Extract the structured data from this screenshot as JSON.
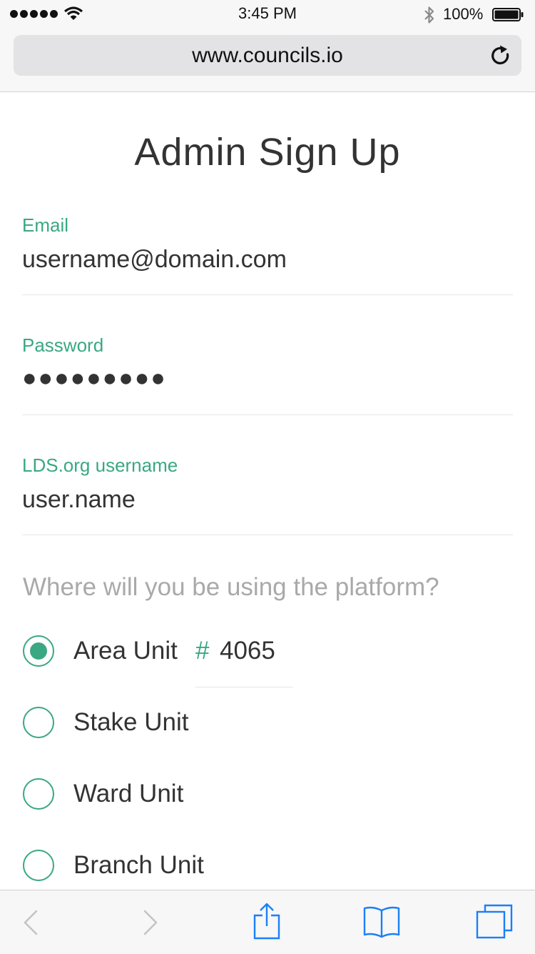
{
  "status_bar": {
    "time": "3:45 PM",
    "battery": "100%",
    "signal_icon": "signal-dots-icon",
    "wifi_icon": "wifi-icon",
    "bluetooth_icon": "bluetooth-icon",
    "battery_icon": "battery-icon"
  },
  "browser": {
    "url": "www.councils.io",
    "reload_icon": "reload-icon"
  },
  "form": {
    "title": "Admin Sign Up",
    "email": {
      "label": "Email",
      "value": "username@domain.com"
    },
    "password": {
      "label": "Password",
      "value": "●●●●●●●●●"
    },
    "lds_username": {
      "label": "LDS.org username",
      "value": "user.name"
    },
    "question": "Where will you be using the platform?",
    "options": [
      {
        "label": "Area Unit",
        "selected": true,
        "number_prefix": "#",
        "number": "4065"
      },
      {
        "label": "Stake Unit",
        "selected": false
      },
      {
        "label": "Ward Unit",
        "selected": false
      },
      {
        "label": "Branch Unit",
        "selected": false
      }
    ]
  },
  "toolbar": {
    "back_icon": "back-chevron-icon",
    "forward_icon": "forward-chevron-icon",
    "share_icon": "share-icon",
    "bookmarks_icon": "bookmarks-icon",
    "tabs_icon": "tabs-icon"
  },
  "colors": {
    "accent": "#3aa882",
    "text": "#333333",
    "placeholder": "#a9a9a9",
    "ios_blue": "#1b7ff8"
  }
}
